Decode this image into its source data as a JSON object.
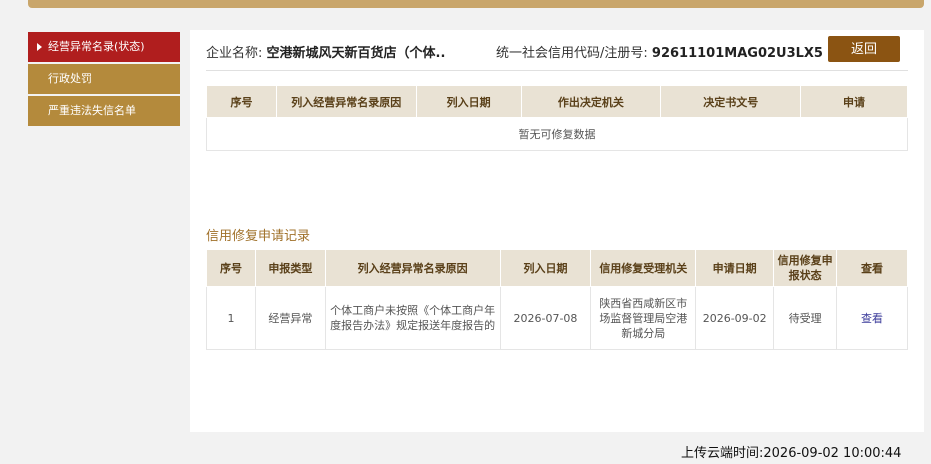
{
  "sidebar": {
    "items": [
      {
        "label": "经营异常名录(状态)",
        "active": true
      },
      {
        "label": "行政处罚",
        "active": false
      },
      {
        "label": "严重违法失信名单",
        "active": false
      }
    ]
  },
  "header": {
    "company_label": "企业名称:",
    "company_value": "空港新城风天新百货店（个体..",
    "code_label": "统一社会信用代码/注册号:",
    "code_value": "92611101MAG02U3LX5",
    "back_label": "返回"
  },
  "abnormal_table": {
    "headers": [
      "序号",
      "列入经营异常名录原因",
      "列入日期",
      "作出决定机关",
      "决定书文号",
      "申请"
    ],
    "empty_text": "暂无可修复数据"
  },
  "repair_section": {
    "title": "信用修复申请记录",
    "headers": [
      "序号",
      "申报类型",
      "列入经营异常名录原因",
      "列入日期",
      "信用修复受理机关",
      "申请日期",
      "信用修复申报状态",
      "查看"
    ],
    "rows": [
      {
        "index": "1",
        "type": "经营异常",
        "reason": "个体工商户未按照《个体工商户年度报告办法》规定报送年度报告的",
        "date": "2026-07-08",
        "authority": "陕西省西咸新区市场监督管理局空港新城分局",
        "apply_date": "2026-09-02",
        "status": "待受理",
        "view": "查看"
      }
    ]
  },
  "footer": {
    "upload_time": "上传云端时间:2026-09-02 10:00:44"
  },
  "colors": {
    "accent_red": "#b01e1e",
    "accent_gold": "#b48a3c",
    "button_brown": "#8b5412"
  }
}
